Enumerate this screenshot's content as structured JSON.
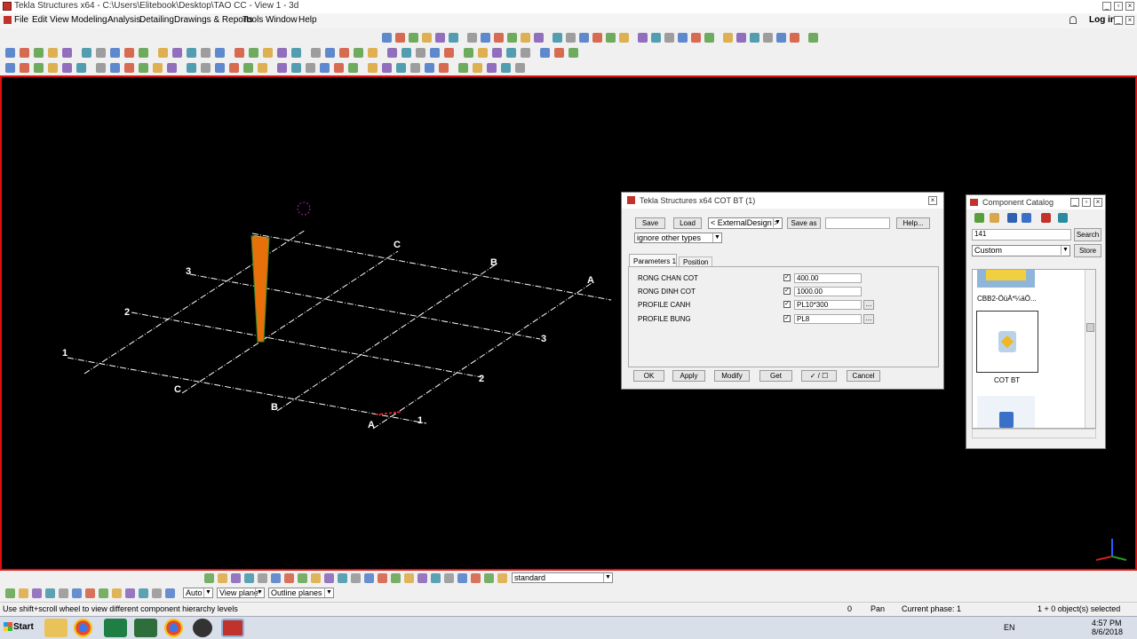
{
  "window": {
    "title": "Tekla Structures x64 - C:\\Users\\Elitebook\\Desktop\\TAO CC - View 1 - 3d"
  },
  "menu": {
    "items": [
      "File",
      "Edit",
      "View",
      "Modeling",
      "Analysis",
      "Detailing",
      "Drawings & Reports",
      "Tools",
      "Window",
      "Help"
    ],
    "login": "Log in"
  },
  "viewport": {
    "grid_labels": {
      "num_left": [
        "1",
        "2",
        "3"
      ],
      "num_right": [
        "1",
        "2",
        "3"
      ],
      "let_bottom": [
        "A",
        "B",
        "C"
      ],
      "let_top": [
        "A",
        "B",
        "C"
      ]
    }
  },
  "dialog": {
    "title": "Tekla Structures x64  COT BT (1)",
    "save": "Save",
    "load": "Load",
    "external_design": "< ExternalDesign >",
    "save_as": "Save as",
    "save_as_value": "",
    "help": "Help...",
    "ignore": "ignore other types",
    "tabs": [
      "Parameters 1",
      "Position"
    ],
    "params": [
      {
        "label": "RONG CHAN COT",
        "value": "400.00",
        "has_browse": false
      },
      {
        "label": "RONG DINH COT",
        "value": "1000.00",
        "has_browse": false
      },
      {
        "label": "PROFILE CANH",
        "value": "PL10*300",
        "has_browse": true
      },
      {
        "label": "PROFILE BUNG",
        "value": "PL8",
        "has_browse": true
      }
    ],
    "browse": "...",
    "check_mark": "✓",
    "ok": "OK",
    "apply": "Apply",
    "modify": "Modify",
    "get": "Get",
    "toggle": "✓ / ☐",
    "cancel": "Cancel"
  },
  "catalog": {
    "title": "Component Catalog",
    "search_value": "141",
    "search": "Search",
    "filter": "Custom",
    "store": "Store",
    "item1": "CBB2-ÖüÄ*¼äÖ...",
    "item2": "COT BT"
  },
  "bottom": {
    "view_name": "standard",
    "auto": "Auto",
    "view_plane": "View plane",
    "outline_planes": "Outline planes"
  },
  "status": {
    "hint": "Use shift+scroll wheel to view different component hierarchy levels",
    "zero": "0",
    "pan": "Pan",
    "phase": "Current phase: 1",
    "selected": "1 + 0 object(s) selected"
  },
  "taskbar": {
    "start": "Start",
    "lang": "EN",
    "time": "4:57 PM",
    "date": "8/6/2018"
  },
  "colors": {
    "viewport_bg": "#000000",
    "viewport_border": "#e01010",
    "column": "#e8700a"
  }
}
